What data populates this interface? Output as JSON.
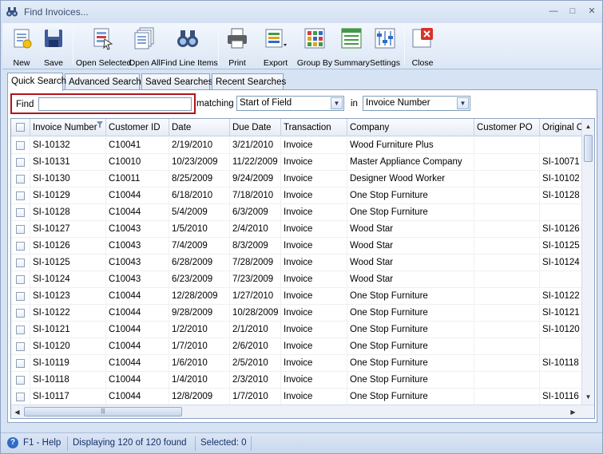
{
  "window": {
    "title": "Find Invoices..."
  },
  "toolbar": [
    {
      "label": "New",
      "icon": "new-document-icon"
    },
    {
      "label": "Save",
      "icon": "save-disk-icon"
    },
    {
      "label": "Open Selected",
      "icon": "open-selected-icon"
    },
    {
      "label": "Open All",
      "icon": "open-all-icon"
    },
    {
      "label": "Find Line Items",
      "icon": "binoculars-icon"
    },
    {
      "label": "Print",
      "icon": "printer-icon"
    },
    {
      "label": "Export",
      "icon": "export-icon"
    },
    {
      "label": "Group By",
      "icon": "group-by-icon"
    },
    {
      "label": "Summary",
      "icon": "summary-icon"
    },
    {
      "label": "Settings",
      "icon": "settings-icon"
    },
    {
      "label": "Close",
      "icon": "close-icon"
    }
  ],
  "tabs": [
    "Quick Search",
    "Advanced Search",
    "Saved Searches",
    "Recent Searches"
  ],
  "find": {
    "label": "Find",
    "value": "",
    "matching_label": "matching",
    "matching_value": "Start of Field",
    "in_label": "in",
    "in_value": "Invoice Number"
  },
  "grid": {
    "columns": [
      "Invoice Number",
      "Customer ID",
      "Date",
      "Due Date",
      "Transaction",
      "Company",
      "Customer PO",
      "Original Or"
    ],
    "rows": [
      [
        "SI-10132",
        "C10041",
        "2/19/2010",
        "3/21/2010",
        "Invoice",
        "Wood Furniture Plus",
        "",
        ""
      ],
      [
        "SI-10131",
        "C10010",
        "10/23/2009",
        "11/22/2009",
        "Invoice",
        "Master Appliance Company",
        "",
        "SI-10071"
      ],
      [
        "SI-10130",
        "C10011",
        "8/25/2009",
        "9/24/2009",
        "Invoice",
        "Designer Wood Worker",
        "",
        "SI-10102"
      ],
      [
        "SI-10129",
        "C10044",
        "6/18/2010",
        "7/18/2010",
        "Invoice",
        "One Stop Furniture",
        "",
        "SI-10128"
      ],
      [
        "SI-10128",
        "C10044",
        "5/4/2009",
        "6/3/2009",
        "Invoice",
        "One Stop Furniture",
        "",
        ""
      ],
      [
        "SI-10127",
        "C10043",
        "1/5/2010",
        "2/4/2010",
        "Invoice",
        "Wood Star",
        "",
        "SI-10126"
      ],
      [
        "SI-10126",
        "C10043",
        "7/4/2009",
        "8/3/2009",
        "Invoice",
        "Wood Star",
        "",
        "SI-10125"
      ],
      [
        "SI-10125",
        "C10043",
        "6/28/2009",
        "7/28/2009",
        "Invoice",
        "Wood Star",
        "",
        "SI-10124"
      ],
      [
        "SI-10124",
        "C10043",
        "6/23/2009",
        "7/23/2009",
        "Invoice",
        "Wood Star",
        "",
        ""
      ],
      [
        "SI-10123",
        "C10044",
        "12/28/2009",
        "1/27/2010",
        "Invoice",
        "One Stop Furniture",
        "",
        "SI-10122"
      ],
      [
        "SI-10122",
        "C10044",
        "9/28/2009",
        "10/28/2009",
        "Invoice",
        "One Stop Furniture",
        "",
        "SI-10121"
      ],
      [
        "SI-10121",
        "C10044",
        "1/2/2010",
        "2/1/2010",
        "Invoice",
        "One Stop Furniture",
        "",
        "SI-10120"
      ],
      [
        "SI-10120",
        "C10044",
        "1/7/2010",
        "2/6/2010",
        "Invoice",
        "One Stop Furniture",
        "",
        ""
      ],
      [
        "SI-10119",
        "C10044",
        "1/6/2010",
        "2/5/2010",
        "Invoice",
        "One Stop Furniture",
        "",
        "SI-10118"
      ],
      [
        "SI-10118",
        "C10044",
        "1/4/2010",
        "2/3/2010",
        "Invoice",
        "One Stop Furniture",
        "",
        ""
      ],
      [
        "SI-10117",
        "C10044",
        "12/8/2009",
        "1/7/2010",
        "Invoice",
        "One Stop Furniture",
        "",
        "SI-10116"
      ]
    ]
  },
  "status": {
    "help": "F1 - Help",
    "displaying": "Displaying 120 of 120 found",
    "selected": "Selected: 0"
  }
}
